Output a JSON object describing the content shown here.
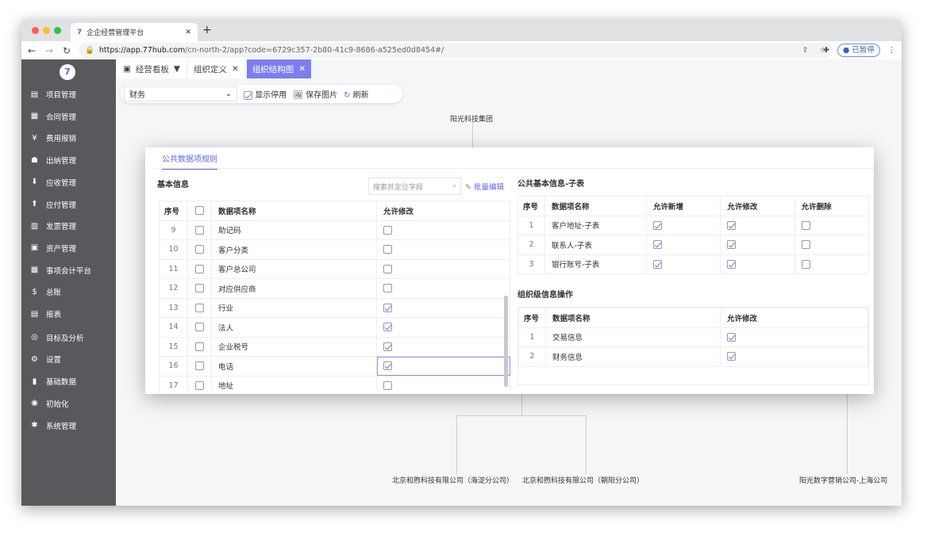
{
  "browser": {
    "tab_title": "企企经营管理平台",
    "url_host": "https://app.77hub.com",
    "url_path": "/cn-north-2/app?code=6729c357-2b80-41c9-8686-a525ed0d8454#/",
    "profile_label": "已暂停"
  },
  "sidebar": {
    "logo": "7",
    "items": [
      {
        "label": "项目管理",
        "icon": "folder-icon",
        "glyph": "▤"
      },
      {
        "label": "合同管理",
        "icon": "contract-icon",
        "glyph": "▦"
      },
      {
        "label": "费用报销",
        "icon": "yen-icon",
        "glyph": "¥"
      },
      {
        "label": "出纳管理",
        "icon": "cashier-icon",
        "glyph": "☗"
      },
      {
        "label": "应收管理",
        "icon": "receivable-icon",
        "glyph": "⬇"
      },
      {
        "label": "应付管理",
        "icon": "payable-icon",
        "glyph": "⬆"
      },
      {
        "label": "发票管理",
        "icon": "invoice-icon",
        "glyph": "▥"
      },
      {
        "label": "资产管理",
        "icon": "asset-icon",
        "glyph": "▣"
      },
      {
        "label": "事项会计平台",
        "icon": "grid-icon",
        "glyph": "▦"
      },
      {
        "label": "总账",
        "icon": "ledger-icon",
        "glyph": "$"
      },
      {
        "label": "报表",
        "icon": "report-icon",
        "glyph": "▤"
      },
      {
        "label": "目标及分析",
        "icon": "target-icon",
        "glyph": "◎"
      },
      {
        "label": "设置",
        "icon": "gear-icon",
        "glyph": "⚙"
      },
      {
        "label": "基础数据",
        "icon": "bar-chart-icon",
        "glyph": "▮"
      },
      {
        "label": "初始化",
        "icon": "refresh-icon",
        "glyph": "◉"
      },
      {
        "label": "系统管理",
        "icon": "asterisk-icon",
        "glyph": "✱"
      }
    ]
  },
  "page_tabs": [
    {
      "label": "经营看板",
      "active": false
    },
    {
      "label": "组织定义",
      "active": false
    },
    {
      "label": "组织结构图",
      "active": true
    }
  ],
  "toolbar": {
    "select_value": "财务",
    "show_disabled": "显示停用",
    "save_image": "保存图片",
    "refresh": "刷新"
  },
  "org": {
    "root": "阳光科技集团",
    "children": [
      "北京和煦科技有限公司（海淀分公司）",
      "北京和煦科技有限公司（朝阳分公司）",
      "阳光数字营销公司-上海公司"
    ]
  },
  "modal": {
    "tab": "公共数据项规则",
    "basic": {
      "title": "基本信息",
      "search_placeholder": "搜索并定位字段",
      "bulk_edit": "批量编辑",
      "headers": [
        "序号",
        "数据项名称",
        "允许修改"
      ],
      "rows": [
        {
          "no": "9",
          "name": "助记码",
          "edit": false
        },
        {
          "no": "10",
          "name": "客户分类",
          "edit": false
        },
        {
          "no": "11",
          "name": "客户总公司",
          "edit": false
        },
        {
          "no": "12",
          "name": "对应供应商",
          "edit": false
        },
        {
          "no": "13",
          "name": "行业",
          "edit": true
        },
        {
          "no": "14",
          "name": "法人",
          "edit": true
        },
        {
          "no": "15",
          "name": "企业税号",
          "edit": true
        },
        {
          "no": "16",
          "name": "电话",
          "edit": true
        },
        {
          "no": "17",
          "name": "地址",
          "edit": false
        }
      ]
    },
    "sub": {
      "title": "公共基本信息-子表",
      "headers": [
        "序号",
        "数据项名称",
        "允许新增",
        "允许修改",
        "允许删除"
      ],
      "rows": [
        {
          "no": "1",
          "name": "客户地址-子表",
          "add": true,
          "edit": true,
          "del": false
        },
        {
          "no": "2",
          "name": "联系人-子表",
          "add": true,
          "edit": true,
          "del": false
        },
        {
          "no": "3",
          "name": "银行账号-子表",
          "add": true,
          "edit": true,
          "del": false
        }
      ]
    },
    "org_ops": {
      "title": "组织级信息操作",
      "headers": [
        "序号",
        "数据项名称",
        "允许修改"
      ],
      "rows": [
        {
          "no": "1",
          "name": "交易信息",
          "edit": true
        },
        {
          "no": "2",
          "name": "财务信息",
          "edit": true
        }
      ]
    }
  },
  "colors": {
    "accent": "#6166e8",
    "sidebar": "#58595d",
    "active_tab": "#7b7ff0"
  }
}
